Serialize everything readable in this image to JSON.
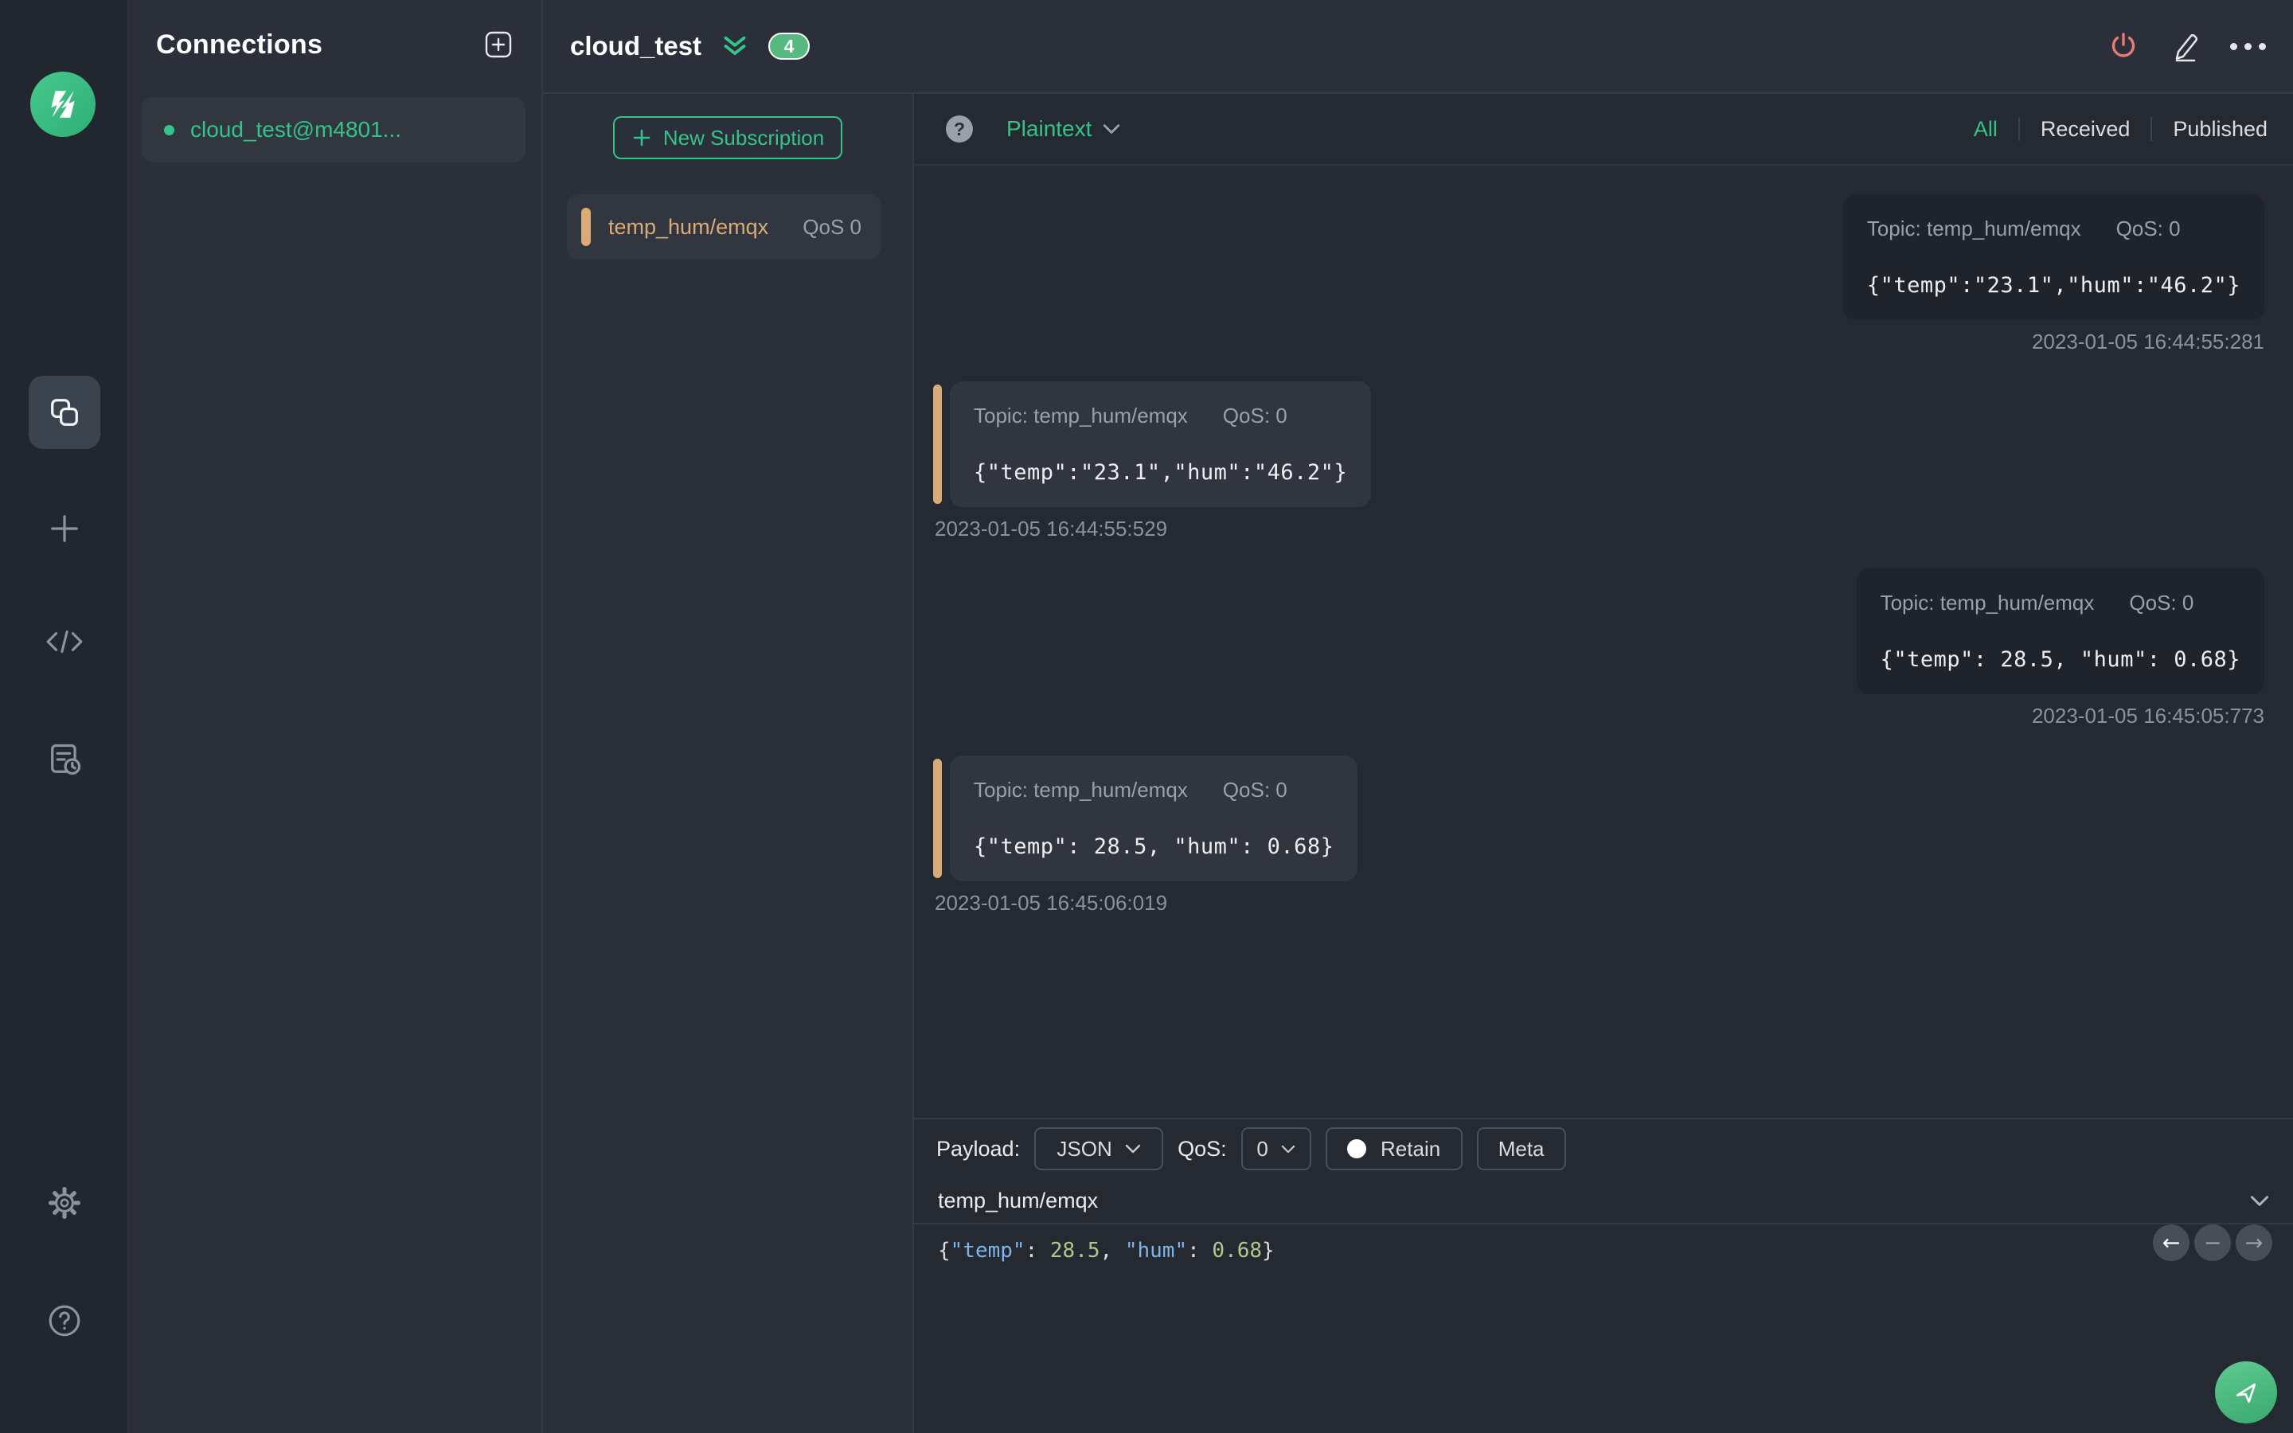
{
  "colors": {
    "accent_green": "#34c388",
    "accent_tan": "#d9ab79",
    "danger_coral": "#e97b72",
    "badge_green": "#57b97f",
    "bubble_published": "#1f232b",
    "bubble_received": "#30353f"
  },
  "sidebar": {
    "icons": [
      "mqttx-logo",
      "connections",
      "new-window",
      "script",
      "log",
      "settings",
      "help"
    ]
  },
  "connections": {
    "title": "Connections",
    "items": [
      {
        "name": "cloud_test@m4801...",
        "status": "connected"
      }
    ]
  },
  "header": {
    "title": "cloud_test",
    "badge_count": "4"
  },
  "subscriptions": {
    "new_button": "New Subscription",
    "items": [
      {
        "topic": "temp_hum/emqx",
        "qos": "QoS 0"
      }
    ]
  },
  "messages": {
    "format": "Plaintext",
    "filters": {
      "all": "All",
      "received": "Received",
      "published": "Published"
    },
    "active_filter": "All",
    "items": [
      {
        "side": "right",
        "topic_label": "Topic: temp_hum/emqx",
        "qos_label": "QoS: 0",
        "payload": "{\"temp\":\"23.1\",\"hum\":\"46.2\"}",
        "time": "2023-01-05 16:44:55:281"
      },
      {
        "side": "left",
        "topic_label": "Topic: temp_hum/emqx",
        "qos_label": "QoS: 0",
        "payload": "{\"temp\":\"23.1\",\"hum\":\"46.2\"}",
        "time": "2023-01-05 16:44:55:529"
      },
      {
        "side": "right",
        "topic_label": "Topic: temp_hum/emqx",
        "qos_label": "QoS: 0",
        "payload": "{\"temp\": 28.5, \"hum\": 0.68}",
        "time": "2023-01-05 16:45:05:773"
      },
      {
        "side": "left",
        "topic_label": "Topic: temp_hum/emqx",
        "qos_label": "QoS: 0",
        "payload": "{\"temp\": 28.5, \"hum\": 0.68}",
        "time": "2023-01-05 16:45:06:019"
      }
    ]
  },
  "publish": {
    "payload_label": "Payload:",
    "payload_format": "JSON",
    "qos_label": "QoS:",
    "qos_value": "0",
    "retain_label": "Retain",
    "meta_label": "Meta",
    "topic": "temp_hum/emqx",
    "editor": {
      "b_open": "{",
      "k1": "\"temp\"",
      "c1": ": ",
      "n1": "28.5",
      "comma": ", ",
      "k2": "\"hum\"",
      "c2": ": ",
      "n2": "0.68",
      "b_close": "}"
    },
    "nav": {
      "back": "←",
      "collapse": "−",
      "forward": "→"
    }
  }
}
